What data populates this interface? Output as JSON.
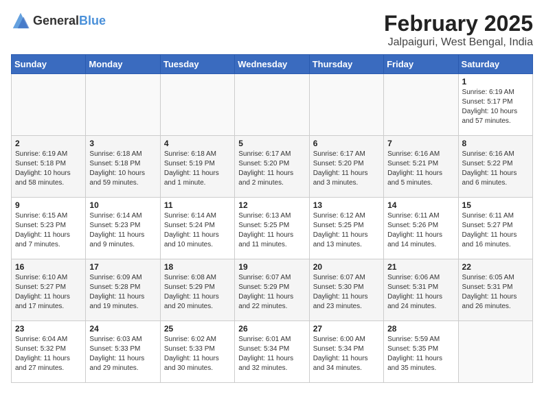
{
  "logo": {
    "general": "General",
    "blue": "Blue"
  },
  "title": "February 2025",
  "subtitle": "Jalpaiguri, West Bengal, India",
  "days_of_week": [
    "Sunday",
    "Monday",
    "Tuesday",
    "Wednesday",
    "Thursday",
    "Friday",
    "Saturday"
  ],
  "weeks": [
    [
      {
        "day": "",
        "info": ""
      },
      {
        "day": "",
        "info": ""
      },
      {
        "day": "",
        "info": ""
      },
      {
        "day": "",
        "info": ""
      },
      {
        "day": "",
        "info": ""
      },
      {
        "day": "",
        "info": ""
      },
      {
        "day": "1",
        "info": "Sunrise: 6:19 AM\nSunset: 5:17 PM\nDaylight: 10 hours and 57 minutes."
      }
    ],
    [
      {
        "day": "2",
        "info": "Sunrise: 6:19 AM\nSunset: 5:18 PM\nDaylight: 10 hours and 58 minutes."
      },
      {
        "day": "3",
        "info": "Sunrise: 6:18 AM\nSunset: 5:18 PM\nDaylight: 10 hours and 59 minutes."
      },
      {
        "day": "4",
        "info": "Sunrise: 6:18 AM\nSunset: 5:19 PM\nDaylight: 11 hours and 1 minute."
      },
      {
        "day": "5",
        "info": "Sunrise: 6:17 AM\nSunset: 5:20 PM\nDaylight: 11 hours and 2 minutes."
      },
      {
        "day": "6",
        "info": "Sunrise: 6:17 AM\nSunset: 5:20 PM\nDaylight: 11 hours and 3 minutes."
      },
      {
        "day": "7",
        "info": "Sunrise: 6:16 AM\nSunset: 5:21 PM\nDaylight: 11 hours and 5 minutes."
      },
      {
        "day": "8",
        "info": "Sunrise: 6:16 AM\nSunset: 5:22 PM\nDaylight: 11 hours and 6 minutes."
      }
    ],
    [
      {
        "day": "9",
        "info": "Sunrise: 6:15 AM\nSunset: 5:23 PM\nDaylight: 11 hours and 7 minutes."
      },
      {
        "day": "10",
        "info": "Sunrise: 6:14 AM\nSunset: 5:23 PM\nDaylight: 11 hours and 9 minutes."
      },
      {
        "day": "11",
        "info": "Sunrise: 6:14 AM\nSunset: 5:24 PM\nDaylight: 11 hours and 10 minutes."
      },
      {
        "day": "12",
        "info": "Sunrise: 6:13 AM\nSunset: 5:25 PM\nDaylight: 11 hours and 11 minutes."
      },
      {
        "day": "13",
        "info": "Sunrise: 6:12 AM\nSunset: 5:25 PM\nDaylight: 11 hours and 13 minutes."
      },
      {
        "day": "14",
        "info": "Sunrise: 6:11 AM\nSunset: 5:26 PM\nDaylight: 11 hours and 14 minutes."
      },
      {
        "day": "15",
        "info": "Sunrise: 6:11 AM\nSunset: 5:27 PM\nDaylight: 11 hours and 16 minutes."
      }
    ],
    [
      {
        "day": "16",
        "info": "Sunrise: 6:10 AM\nSunset: 5:27 PM\nDaylight: 11 hours and 17 minutes."
      },
      {
        "day": "17",
        "info": "Sunrise: 6:09 AM\nSunset: 5:28 PM\nDaylight: 11 hours and 19 minutes."
      },
      {
        "day": "18",
        "info": "Sunrise: 6:08 AM\nSunset: 5:29 PM\nDaylight: 11 hours and 20 minutes."
      },
      {
        "day": "19",
        "info": "Sunrise: 6:07 AM\nSunset: 5:29 PM\nDaylight: 11 hours and 22 minutes."
      },
      {
        "day": "20",
        "info": "Sunrise: 6:07 AM\nSunset: 5:30 PM\nDaylight: 11 hours and 23 minutes."
      },
      {
        "day": "21",
        "info": "Sunrise: 6:06 AM\nSunset: 5:31 PM\nDaylight: 11 hours and 24 minutes."
      },
      {
        "day": "22",
        "info": "Sunrise: 6:05 AM\nSunset: 5:31 PM\nDaylight: 11 hours and 26 minutes."
      }
    ],
    [
      {
        "day": "23",
        "info": "Sunrise: 6:04 AM\nSunset: 5:32 PM\nDaylight: 11 hours and 27 minutes."
      },
      {
        "day": "24",
        "info": "Sunrise: 6:03 AM\nSunset: 5:33 PM\nDaylight: 11 hours and 29 minutes."
      },
      {
        "day": "25",
        "info": "Sunrise: 6:02 AM\nSunset: 5:33 PM\nDaylight: 11 hours and 30 minutes."
      },
      {
        "day": "26",
        "info": "Sunrise: 6:01 AM\nSunset: 5:34 PM\nDaylight: 11 hours and 32 minutes."
      },
      {
        "day": "27",
        "info": "Sunrise: 6:00 AM\nSunset: 5:34 PM\nDaylight: 11 hours and 34 minutes."
      },
      {
        "day": "28",
        "info": "Sunrise: 5:59 AM\nSunset: 5:35 PM\nDaylight: 11 hours and 35 minutes."
      },
      {
        "day": "",
        "info": ""
      }
    ]
  ]
}
